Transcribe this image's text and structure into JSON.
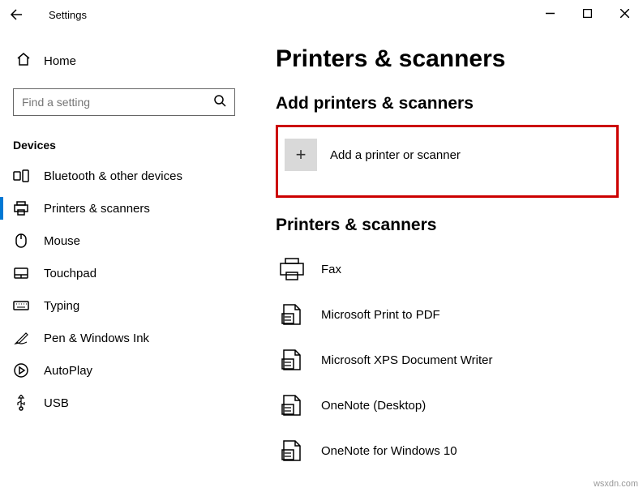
{
  "titlebar": {
    "app_title": "Settings"
  },
  "sidebar": {
    "home_label": "Home",
    "search_placeholder": "Find a setting",
    "group_header": "Devices",
    "items": [
      {
        "label": "Bluetooth & other devices",
        "icon": "bluetooth-devices-icon"
      },
      {
        "label": "Printers & scanners",
        "icon": "printer-icon"
      },
      {
        "label": "Mouse",
        "icon": "mouse-icon"
      },
      {
        "label": "Touchpad",
        "icon": "touchpad-icon"
      },
      {
        "label": "Typing",
        "icon": "keyboard-icon"
      },
      {
        "label": "Pen & Windows Ink",
        "icon": "pen-icon"
      },
      {
        "label": "AutoPlay",
        "icon": "autoplay-icon"
      },
      {
        "label": "USB",
        "icon": "usb-icon"
      }
    ]
  },
  "main": {
    "page_title": "Printers & scanners",
    "add_section_head": "Add printers & scanners",
    "add_button_label": "Add a printer or scanner",
    "list_section_head": "Printers & scanners",
    "printers": [
      {
        "label": "Fax"
      },
      {
        "label": "Microsoft Print to PDF"
      },
      {
        "label": "Microsoft XPS Document Writer"
      },
      {
        "label": "OneNote (Desktop)"
      },
      {
        "label": "OneNote for Windows 10"
      }
    ]
  },
  "watermark": "wsxdn.com"
}
